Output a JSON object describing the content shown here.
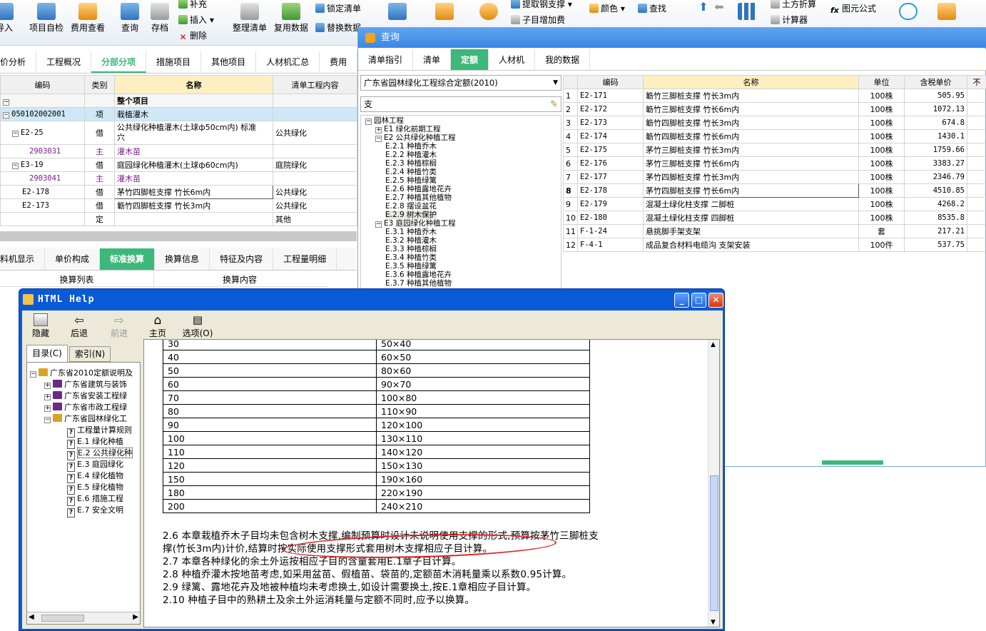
{
  "ribbon": {
    "btn_import": "导入",
    "btn_self_check": "项目自检",
    "btn_fee_view": "费用查看",
    "btn_query": "查询",
    "btn_save": "存档",
    "btn_supplement": "补充",
    "btn_insert": "插入",
    "btn_delete": "删除",
    "btn_tidy": "整理清单",
    "btn_reuse": "复用数据",
    "btn_lock": "锁定清单",
    "btn_replace": "替换数据",
    "btn_rebar": "提取钢支撑",
    "btn_subitem_fee": "子目增加费",
    "btn_color": "颜色",
    "btn_find": "查找",
    "btn_earthwork": "土方折算",
    "btn_calc": "计算器",
    "btn_formula": "图元公式"
  },
  "main_tabs": {
    "t0": "价分析",
    "t1": "工程概况",
    "t2": "分部分项",
    "t3": "措施项目",
    "t4": "其他项目",
    "t5": "人材机汇总",
    "t6": "费用"
  },
  "left_table": {
    "headers": {
      "code": "编码",
      "type": "类别",
      "name": "名称",
      "content": "清单工程内容"
    },
    "rows": [
      {
        "code": "",
        "type": "",
        "name": "整个项目",
        "content": ""
      },
      {
        "code": "050102002001",
        "type": "项",
        "name": "栽植灌木",
        "content": ""
      },
      {
        "code": "E2-25",
        "type": "借",
        "name": "公共绿化种植灌木(土球ф50cm内) 标准",
        "name2": "穴",
        "content": "公共绿化"
      },
      {
        "code": "2903031",
        "type": "主",
        "name": "灌木苗",
        "content": ""
      },
      {
        "code": "E3-19",
        "type": "借",
        "name": "庭园绿化种植灌木(土球ф60cm内)",
        "content": "庭院绿化"
      },
      {
        "code": "2903041",
        "type": "主",
        "name": "灌木苗",
        "content": ""
      },
      {
        "code": "E2-178",
        "type": "借",
        "name": "茅竹四脚桩支撑 竹长6m内",
        "content": "公共绿化"
      },
      {
        "code": "E2-173",
        "type": "借",
        "name": "簕竹四脚桩支撑 竹长3m内",
        "content": "公共绿化"
      },
      {
        "code": "",
        "type": "定",
        "name": "",
        "content": "其他"
      }
    ]
  },
  "bottom_tabs": {
    "t0": "料机显示",
    "t1": "单价构成",
    "t2": "标准换算",
    "t3": "换算信息",
    "t4": "特征及内容",
    "t5": "工程量明细"
  },
  "bottom_headers": {
    "h0": "换算列表",
    "h1": "换算内容"
  },
  "query": {
    "title": "查询",
    "tabs": {
      "t0": "清单指引",
      "t1": "清单",
      "t2": "定额",
      "t3": "人材机",
      "t4": "我的数据"
    },
    "library": "广东省园林绿化工程综合定额(2010)",
    "search": "支",
    "tree": [
      {
        "text": "园林工程",
        "lvl": 0,
        "sign": "−"
      },
      {
        "text": "E1 绿化前期工程",
        "lvl": 1,
        "sign": "+"
      },
      {
        "text": "E2 公共绿化种植工程",
        "lvl": 1,
        "sign": "−"
      },
      {
        "text": "E.2.1 种植乔木",
        "lvl": 2
      },
      {
        "text": "E.2.2 种植灌木",
        "lvl": 2
      },
      {
        "text": "E.2.3 种植棕榈",
        "lvl": 2
      },
      {
        "text": "E.2.4 种植竹类",
        "lvl": 2
      },
      {
        "text": "E.2.5 种植绿篱",
        "lvl": 2
      },
      {
        "text": "E.2.6 种植露地花卉",
        "lvl": 2
      },
      {
        "text": "E.2.7 种植其他植物",
        "lvl": 2
      },
      {
        "text": "E.2.8 摆设盆花",
        "lvl": 2
      },
      {
        "text": "E.2.9 树木保护",
        "lvl": 2,
        "sel": true
      },
      {
        "text": "E3 庭园绿化种植工程",
        "lvl": 1,
        "sign": "−"
      },
      {
        "text": "E.3.1 种植乔木",
        "lvl": 2
      },
      {
        "text": "E.3.2 种植灌木",
        "lvl": 2
      },
      {
        "text": "E.3.3 种植棕榈",
        "lvl": 2
      },
      {
        "text": "E.3.4 种植竹类",
        "lvl": 2
      },
      {
        "text": "E.3.5 种植绿篱",
        "lvl": 2
      },
      {
        "text": "E.3.6 种植露地花卉",
        "lvl": 2
      },
      {
        "text": "E.3.7 种植其他植物",
        "lvl": 2
      }
    ],
    "headers": {
      "code": "编码",
      "name": "名称",
      "unit": "单位",
      "price": "含税单价",
      "more": "不"
    },
    "rows": [
      {
        "n": "1",
        "code": "E2-171",
        "name": "簕竹三脚桩支撑 竹长3m内",
        "unit": "100株",
        "price": "505.95"
      },
      {
        "n": "2",
        "code": "E2-172",
        "name": "簕竹三脚桩支撑 竹长6m内",
        "unit": "100株",
        "price": "1072.13"
      },
      {
        "n": "3",
        "code": "E2-173",
        "name": "簕竹四脚桩支撑 竹长3m内",
        "unit": "100株",
        "price": "674.8"
      },
      {
        "n": "4",
        "code": "E2-174",
        "name": "簕竹四脚桩支撑 竹长6m内",
        "unit": "100株",
        "price": "1430.1"
      },
      {
        "n": "5",
        "code": "E2-175",
        "name": "茅竹三脚桩支撑 竹长3m内",
        "unit": "100株",
        "price": "1759.66"
      },
      {
        "n": "6",
        "code": "E2-176",
        "name": "茅竹三脚桩支撑 竹长6m内",
        "unit": "100株",
        "price": "3383.27"
      },
      {
        "n": "7",
        "code": "E2-177",
        "name": "茅竹四脚桩支撑 竹长3m内",
        "unit": "100株",
        "price": "2346.79"
      },
      {
        "n": "8",
        "code": "E2-178",
        "name": "茅竹四脚桩支撑 竹长6m内",
        "unit": "100株",
        "price": "4510.85"
      },
      {
        "n": "9",
        "code": "E2-179",
        "name": "混凝土绿化柱支撑 二脚桩",
        "unit": "100株",
        "price": "4268.2"
      },
      {
        "n": "10",
        "code": "E2-180",
        "name": "混凝土绿化柱支撑 四脚桩",
        "unit": "100株",
        "price": "8535.8"
      },
      {
        "n": "11",
        "code": "F-1-24",
        "name": "悬挑脚手架支架",
        "unit": "套",
        "price": "217.21"
      },
      {
        "n": "12",
        "code": "F-4-1",
        "name": "成品复合材料电缆沟 支架安装",
        "unit": "100件",
        "price": "537.75"
      }
    ]
  },
  "help": {
    "title": "HTML Help",
    "toolbar": {
      "hide": "隐藏",
      "back": "后退",
      "forward": "前进",
      "home": "主页",
      "options": "选项(O)"
    },
    "left_tabs": {
      "contents": "目录(C)",
      "index": "索引(N)"
    },
    "tree": [
      {
        "text": "广东省2010定额说明及",
        "lvl": 0,
        "kind": "openbook",
        "sign": "−"
      },
      {
        "text": "广东省建筑与装饰",
        "lvl": 1,
        "kind": "book",
        "sign": "+"
      },
      {
        "text": "广东省安装工程绿",
        "lvl": 1,
        "kind": "book",
        "sign": "+"
      },
      {
        "text": "广东省市政工程绿",
        "lvl": 1,
        "kind": "book",
        "sign": "+"
      },
      {
        "text": "广东省园林绿化工",
        "lvl": 1,
        "kind": "openbook",
        "sign": "−"
      },
      {
        "text": "工程量计算规则",
        "lvl": 2,
        "kind": "page"
      },
      {
        "text": "E.1 绿化种植",
        "lvl": 2,
        "kind": "page"
      },
      {
        "text": "E.2 公共绿化种",
        "lvl": 2,
        "kind": "page",
        "sel": true
      },
      {
        "text": "E.3 庭园绿化",
        "lvl": 2,
        "kind": "page"
      },
      {
        "text": "E.4 绿化植物",
        "lvl": 2,
        "kind": "page"
      },
      {
        "text": "E.5 绿化植物",
        "lvl": 2,
        "kind": "page"
      },
      {
        "text": "E.6 措施工程",
        "lvl": 2,
        "kind": "page"
      },
      {
        "text": "E.7 安全文明",
        "lvl": 2,
        "kind": "page"
      }
    ],
    "size_table": [
      [
        "30",
        "50×40"
      ],
      [
        "40",
        "60×50"
      ],
      [
        "50",
        "80×60"
      ],
      [
        "60",
        "90×70"
      ],
      [
        "70",
        "100×80"
      ],
      [
        "80",
        "110×90"
      ],
      [
        "90",
        "120×100"
      ],
      [
        "100",
        "130×110"
      ],
      [
        "110",
        "140×120"
      ],
      [
        "120",
        "150×130"
      ],
      [
        "150",
        "190×160"
      ],
      [
        "180",
        "220×190"
      ],
      [
        "200",
        "240×210"
      ]
    ],
    "paragraphs": {
      "p1a": "2.6  本章栽植乔木子目均未包含树木支撑,编制预算时设计未说明使用支撑的形式,预算按茅竹三脚桩支",
      "p1b": "撑(竹长3m内)计价,结算时按实际使用支撑形式套用树木支撑相应子目计算。",
      "p2": "2.7  本章各种绿化的余土外运按相应子目的含量套用E.1章子目计算。",
      "p3": "2.8  种植乔灌木按地苗考虑,如采用盆苗、假植苗、袋苗的,定额苗木消耗量乘以系数0.95计算。",
      "p4": "2.9  绿篱、露地花卉及地被种植均未考虑换土,如设计需要换土,按E.1章相应子目计算。",
      "p5": "2.10  种植子目中的熟耕土及余土外运消耗量与定额不同时,应予以换算。"
    }
  },
  "colors": {
    "accent_green": "#3cb87a",
    "title_blue": "#1763d6",
    "highlight_yellow": "#fdefc2",
    "annotation_red": "#e02020"
  }
}
